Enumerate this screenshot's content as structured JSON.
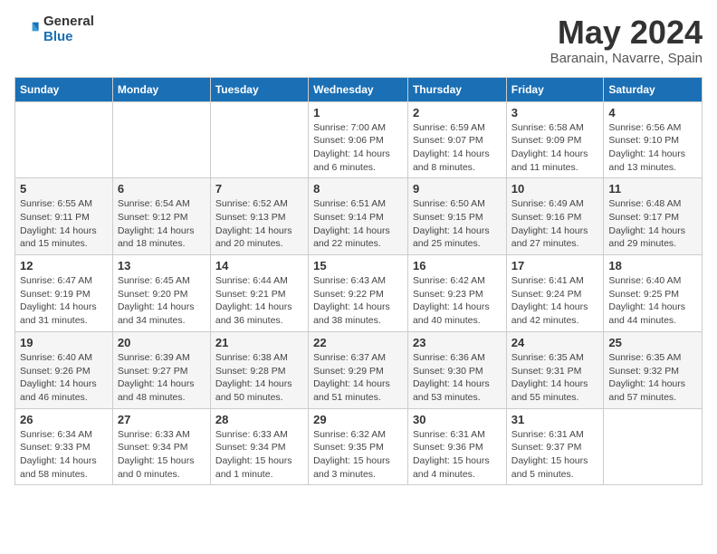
{
  "logo": {
    "general": "General",
    "blue": "Blue"
  },
  "title": "May 2024",
  "location": "Baranain, Navarre, Spain",
  "days_of_week": [
    "Sunday",
    "Monday",
    "Tuesday",
    "Wednesday",
    "Thursday",
    "Friday",
    "Saturday"
  ],
  "weeks": [
    [
      {
        "num": "",
        "detail": ""
      },
      {
        "num": "",
        "detail": ""
      },
      {
        "num": "",
        "detail": ""
      },
      {
        "num": "1",
        "detail": "Sunrise: 7:00 AM\nSunset: 9:06 PM\nDaylight: 14 hours\nand 6 minutes."
      },
      {
        "num": "2",
        "detail": "Sunrise: 6:59 AM\nSunset: 9:07 PM\nDaylight: 14 hours\nand 8 minutes."
      },
      {
        "num": "3",
        "detail": "Sunrise: 6:58 AM\nSunset: 9:09 PM\nDaylight: 14 hours\nand 11 minutes."
      },
      {
        "num": "4",
        "detail": "Sunrise: 6:56 AM\nSunset: 9:10 PM\nDaylight: 14 hours\nand 13 minutes."
      }
    ],
    [
      {
        "num": "5",
        "detail": "Sunrise: 6:55 AM\nSunset: 9:11 PM\nDaylight: 14 hours\nand 15 minutes."
      },
      {
        "num": "6",
        "detail": "Sunrise: 6:54 AM\nSunset: 9:12 PM\nDaylight: 14 hours\nand 18 minutes."
      },
      {
        "num": "7",
        "detail": "Sunrise: 6:52 AM\nSunset: 9:13 PM\nDaylight: 14 hours\nand 20 minutes."
      },
      {
        "num": "8",
        "detail": "Sunrise: 6:51 AM\nSunset: 9:14 PM\nDaylight: 14 hours\nand 22 minutes."
      },
      {
        "num": "9",
        "detail": "Sunrise: 6:50 AM\nSunset: 9:15 PM\nDaylight: 14 hours\nand 25 minutes."
      },
      {
        "num": "10",
        "detail": "Sunrise: 6:49 AM\nSunset: 9:16 PM\nDaylight: 14 hours\nand 27 minutes."
      },
      {
        "num": "11",
        "detail": "Sunrise: 6:48 AM\nSunset: 9:17 PM\nDaylight: 14 hours\nand 29 minutes."
      }
    ],
    [
      {
        "num": "12",
        "detail": "Sunrise: 6:47 AM\nSunset: 9:19 PM\nDaylight: 14 hours\nand 31 minutes."
      },
      {
        "num": "13",
        "detail": "Sunrise: 6:45 AM\nSunset: 9:20 PM\nDaylight: 14 hours\nand 34 minutes."
      },
      {
        "num": "14",
        "detail": "Sunrise: 6:44 AM\nSunset: 9:21 PM\nDaylight: 14 hours\nand 36 minutes."
      },
      {
        "num": "15",
        "detail": "Sunrise: 6:43 AM\nSunset: 9:22 PM\nDaylight: 14 hours\nand 38 minutes."
      },
      {
        "num": "16",
        "detail": "Sunrise: 6:42 AM\nSunset: 9:23 PM\nDaylight: 14 hours\nand 40 minutes."
      },
      {
        "num": "17",
        "detail": "Sunrise: 6:41 AM\nSunset: 9:24 PM\nDaylight: 14 hours\nand 42 minutes."
      },
      {
        "num": "18",
        "detail": "Sunrise: 6:40 AM\nSunset: 9:25 PM\nDaylight: 14 hours\nand 44 minutes."
      }
    ],
    [
      {
        "num": "19",
        "detail": "Sunrise: 6:40 AM\nSunset: 9:26 PM\nDaylight: 14 hours\nand 46 minutes."
      },
      {
        "num": "20",
        "detail": "Sunrise: 6:39 AM\nSunset: 9:27 PM\nDaylight: 14 hours\nand 48 minutes."
      },
      {
        "num": "21",
        "detail": "Sunrise: 6:38 AM\nSunset: 9:28 PM\nDaylight: 14 hours\nand 50 minutes."
      },
      {
        "num": "22",
        "detail": "Sunrise: 6:37 AM\nSunset: 9:29 PM\nDaylight: 14 hours\nand 51 minutes."
      },
      {
        "num": "23",
        "detail": "Sunrise: 6:36 AM\nSunset: 9:30 PM\nDaylight: 14 hours\nand 53 minutes."
      },
      {
        "num": "24",
        "detail": "Sunrise: 6:35 AM\nSunset: 9:31 PM\nDaylight: 14 hours\nand 55 minutes."
      },
      {
        "num": "25",
        "detail": "Sunrise: 6:35 AM\nSunset: 9:32 PM\nDaylight: 14 hours\nand 57 minutes."
      }
    ],
    [
      {
        "num": "26",
        "detail": "Sunrise: 6:34 AM\nSunset: 9:33 PM\nDaylight: 14 hours\nand 58 minutes."
      },
      {
        "num": "27",
        "detail": "Sunrise: 6:33 AM\nSunset: 9:34 PM\nDaylight: 15 hours\nand 0 minutes."
      },
      {
        "num": "28",
        "detail": "Sunrise: 6:33 AM\nSunset: 9:34 PM\nDaylight: 15 hours\nand 1 minute."
      },
      {
        "num": "29",
        "detail": "Sunrise: 6:32 AM\nSunset: 9:35 PM\nDaylight: 15 hours\nand 3 minutes."
      },
      {
        "num": "30",
        "detail": "Sunrise: 6:31 AM\nSunset: 9:36 PM\nDaylight: 15 hours\nand 4 minutes."
      },
      {
        "num": "31",
        "detail": "Sunrise: 6:31 AM\nSunset: 9:37 PM\nDaylight: 15 hours\nand 5 minutes."
      },
      {
        "num": "",
        "detail": ""
      }
    ]
  ]
}
